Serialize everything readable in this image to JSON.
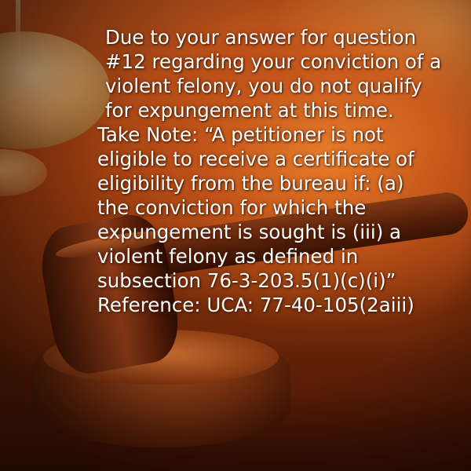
{
  "notice": {
    "paragraph_1": "Due to your answer for question\n#12 regarding your conviction of a\nviolent felony, you do not qualify\nfor expungement at this time.",
    "paragraph_2": "Take Note: “A petitioner is not\neligible to receive a certificate of\neligibility from the bureau if: (a)\nthe conviction for which the\nexpungement is sought is (iii)  a\nviolent felony as defined in\nsubsection 76-3-203.5(1)(c)(i)”",
    "reference": "Reference:  UCA: 77-40-105(2aiii)"
  },
  "colors": {
    "text": "#ffffff",
    "background_warm": "#b5501a",
    "background_dark": "#3d1305"
  }
}
